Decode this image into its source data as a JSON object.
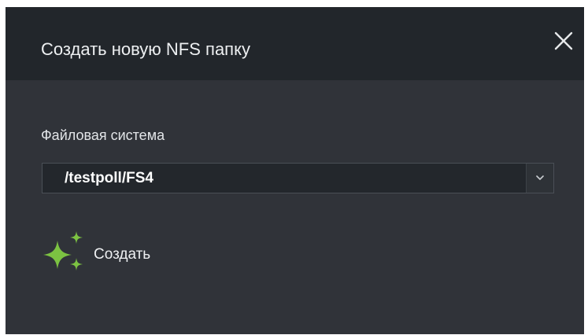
{
  "dialog": {
    "title": "Создать новую NFS папку",
    "close_icon": "close-icon"
  },
  "form": {
    "filesystem_label": "Файловая система",
    "filesystem_value": "/testpoll/FS4",
    "dropdown_icon": "chevron-down-icon"
  },
  "actions": {
    "create_label": "Создать",
    "create_icon": "sparkle-icon"
  },
  "colors": {
    "header_bg": "#22262b",
    "body_bg": "#303339",
    "select_bg": "#23272c",
    "accent_green": "#7cc242"
  }
}
